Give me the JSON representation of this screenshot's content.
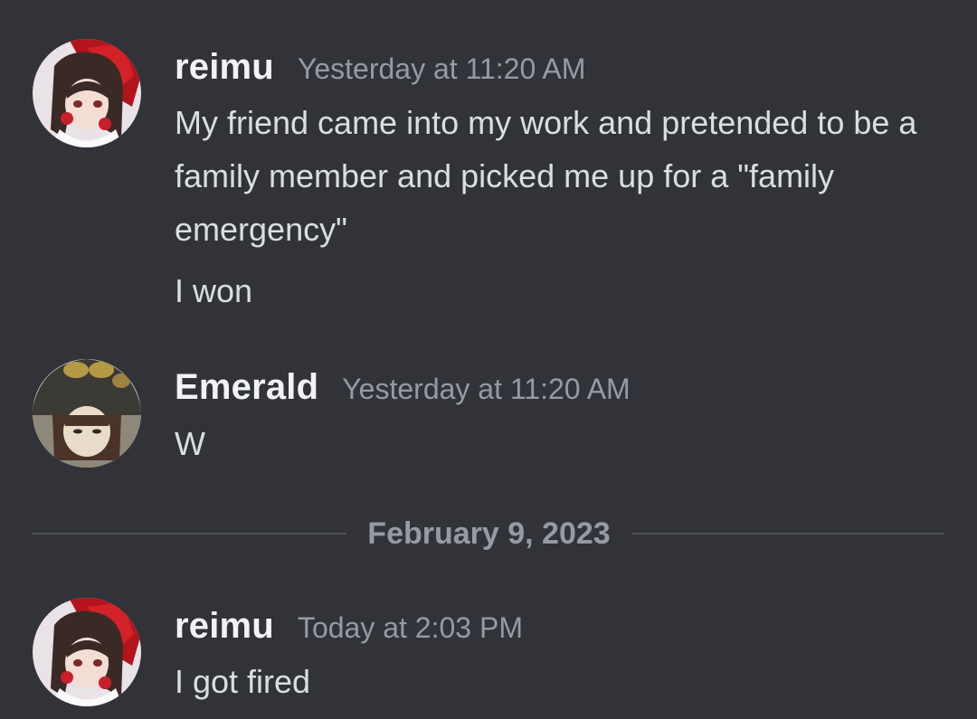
{
  "messages": [
    {
      "username": "reimu",
      "timestamp": "Yesterday at 11:20 AM",
      "avatar_icon": "reimu-avatar",
      "lines": [
        "My friend came into my work and pretended to be a family member and picked me up for a \"family emergency\"",
        "I won"
      ]
    },
    {
      "username": "Emerald",
      "timestamp": "Yesterday at 11:20 AM",
      "avatar_icon": "emerald-avatar",
      "lines": [
        "W"
      ]
    },
    {
      "username": "reimu",
      "timestamp": "Today at 2:03 PM",
      "avatar_icon": "reimu-avatar",
      "lines": [
        "I got fired"
      ]
    }
  ],
  "date_divider": "February 9, 2023",
  "colors": {
    "background": "#313338",
    "username": "#f2f3f5",
    "timestamp": "#949ba4",
    "message_text": "#dbdee1",
    "divider_line": "#4e5058"
  }
}
